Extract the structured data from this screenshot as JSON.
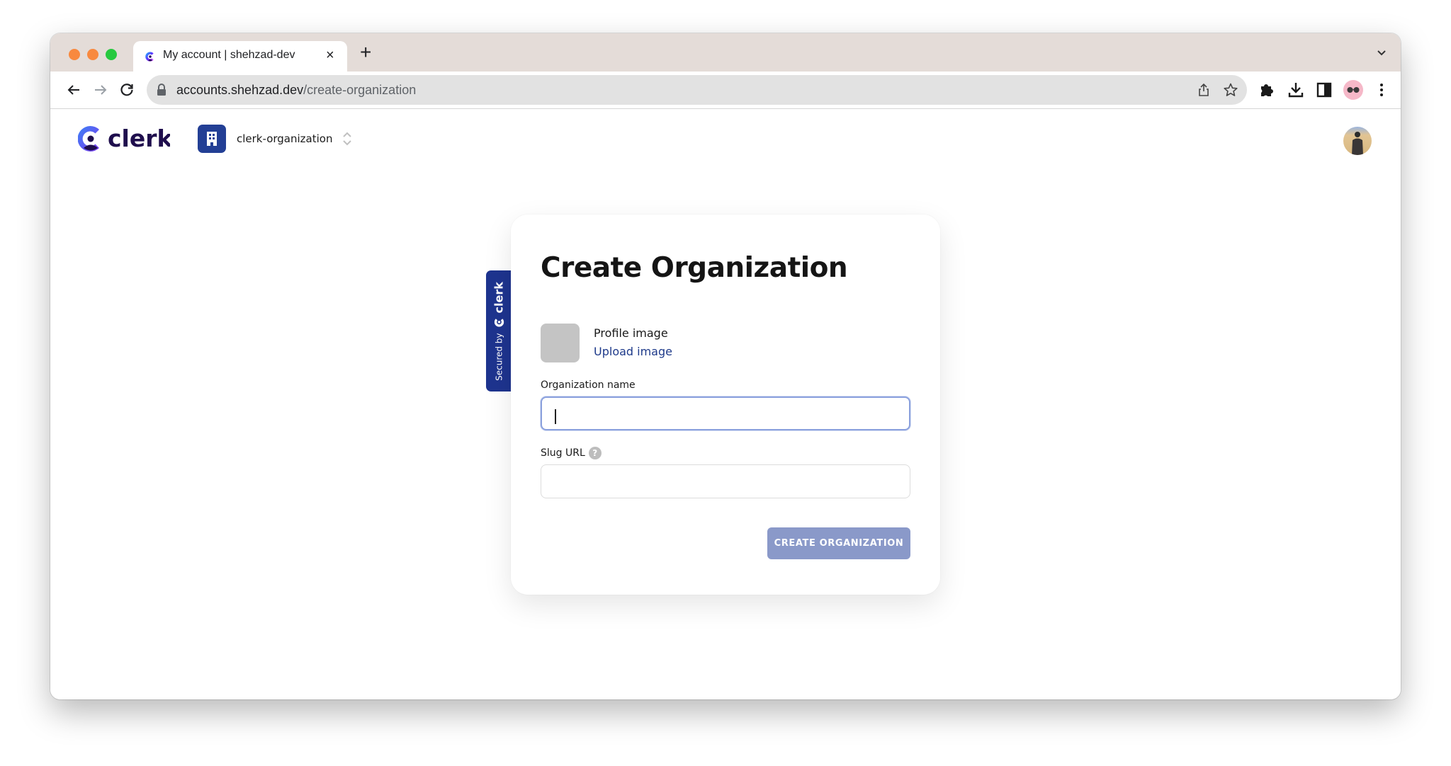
{
  "browser": {
    "tab_title": "My account | shehzad-dev",
    "tab_close_glyph": "×",
    "new_tab_glyph": "+",
    "url_host": "accounts.shehzad.dev",
    "url_path": "/create-organization",
    "traffic_lights": [
      "#f8893f",
      "#f8893f",
      "#27c93f"
    ]
  },
  "header": {
    "logo_text": "clerk",
    "organization_name": "clerk-organization"
  },
  "secured_badge": {
    "label": "Secured by",
    "brand": "clerk"
  },
  "form": {
    "title": "Create Organization",
    "profile_image_label": "Profile image",
    "upload_link": "Upload image",
    "org_name_label": "Organization name",
    "org_name_value": "",
    "slug_label": "Slug URL",
    "slug_help_glyph": "?",
    "slug_value": "",
    "submit_label": "CREATE ORGANIZATION"
  },
  "colors": {
    "brand_navy": "#1e348f",
    "button_disabled": "#8a99c9",
    "link": "#1e3a8a",
    "focus_ring": "#8aa0dd"
  }
}
